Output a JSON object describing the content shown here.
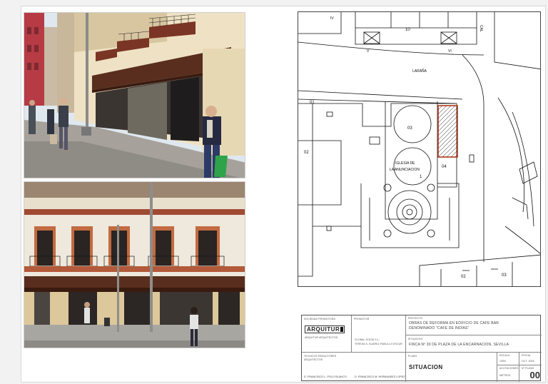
{
  "colors": {
    "highlight": "#b33a1a",
    "line": "#111111",
    "sky": "#dfe8ef",
    "facade": "#efe8dc",
    "awning": "#5a2e1e"
  },
  "map": {
    "street_name": "LARAÑA",
    "church_label_1": "IGLESIA DE",
    "church_label_2": "LA ANUNCIACION",
    "lot_numbers": [
      "10",
      "03",
      "04",
      "02",
      "02",
      "03",
      "01",
      "1"
    ],
    "misc_labels": [
      "IV",
      "V",
      "VI",
      "CAL"
    ]
  },
  "title_block": {
    "developer_label": "SOCIEDAD PROMOTORA",
    "developer_name": "ARQUITUR",
    "developer_sub": "ARQUITUR ARQUITECTOS",
    "owner_label": "PROMOTOR",
    "owner_value_1": "GLOBAL GODIA S.L.",
    "owner_value_2": "TERESA S. SUAREZ PABLILLO ESCUR",
    "project_label": "PROYECTO",
    "project_value_1": "OBRAS DE REFORMA EN EDIFICIO DE CAFE BAR",
    "project_value_2": "DENOMINADO \"CAFE DE INDIAS\"",
    "location_label": "SITUACION",
    "location_value": "FINCA Nº 30 DE PLAZA DE LA ENCARNACION, SEVILLA",
    "authors_label": "TECNICOS REDACTORES",
    "authors_sub": "ARQUITECTOS",
    "plan_label": "PLANO",
    "plan_title": "SITUACION",
    "scale_label": "ESCALA",
    "scale_value": "1/500",
    "date_label": "FECHA",
    "date_value": "OCT. 2009",
    "sheet_label": "Nº PLANO",
    "sheet_number": "00",
    "units_label": "ACOTACIONES",
    "units_value": "METROS",
    "signature_1": "D. FRANCISCO L. POLO BLANCO",
    "signature_2": "D. FRANCISCO M. HERNANDEZ LOPEZ"
  }
}
